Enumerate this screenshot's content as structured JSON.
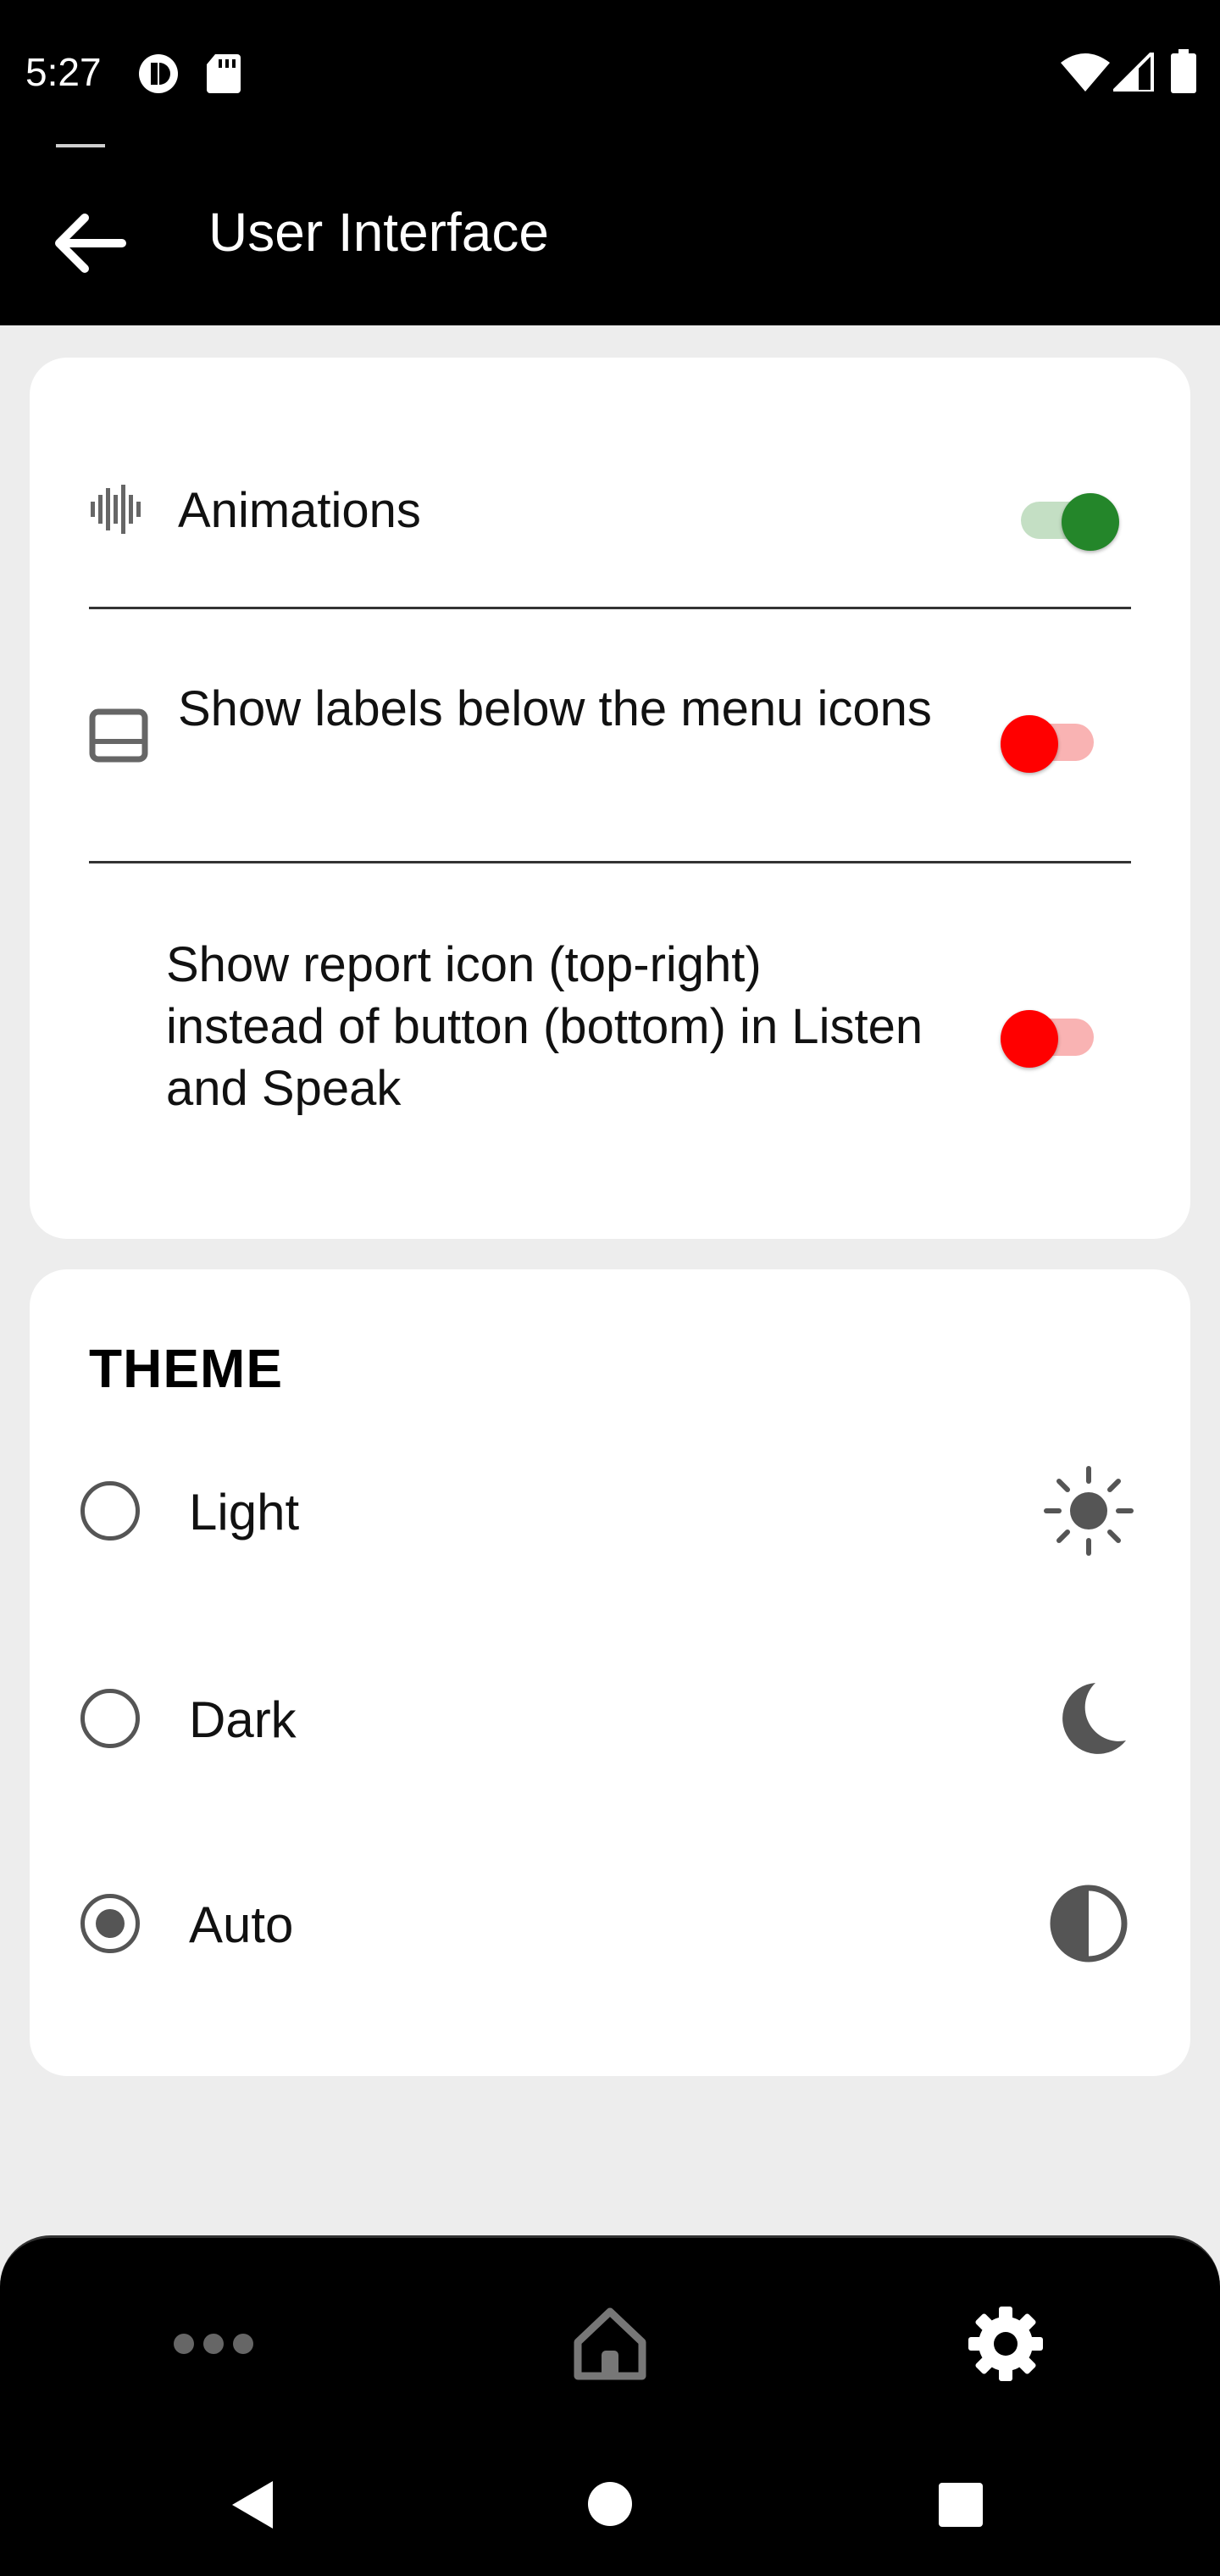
{
  "status_bar": {
    "time": "5:27",
    "icons": [
      "notification-icon",
      "sd-card-icon",
      "wifi-icon",
      "signal-icon",
      "battery-icon"
    ]
  },
  "app_bar": {
    "title": "User Interface",
    "back_icon": "arrow-back-icon"
  },
  "interface_settings": [
    {
      "label": "Animations",
      "icon": "waveform-icon",
      "enabled": true
    },
    {
      "label": "Show labels below the menu icons",
      "icon": "label-bar-icon",
      "enabled": false
    },
    {
      "label": "Show report icon (top-right) instead of button (bottom) in Listen and Speak",
      "icon": "",
      "enabled": false
    }
  ],
  "theme": {
    "title": "THEME",
    "options": [
      {
        "label": "Light",
        "icon": "sun-icon",
        "selected": false
      },
      {
        "label": "Dark",
        "icon": "moon-icon",
        "selected": false
      },
      {
        "label": "Auto",
        "icon": "half-circle-icon",
        "selected": true
      }
    ]
  },
  "bottom_nav": {
    "items": [
      {
        "icon": "more-dots-icon",
        "active": false
      },
      {
        "icon": "home-icon",
        "active": false
      },
      {
        "icon": "gear-icon",
        "active": true
      }
    ]
  },
  "colors": {
    "toggle_on": "#24862a",
    "toggle_off": "#ff0000",
    "background": "#ededed",
    "bar": "#000000"
  }
}
